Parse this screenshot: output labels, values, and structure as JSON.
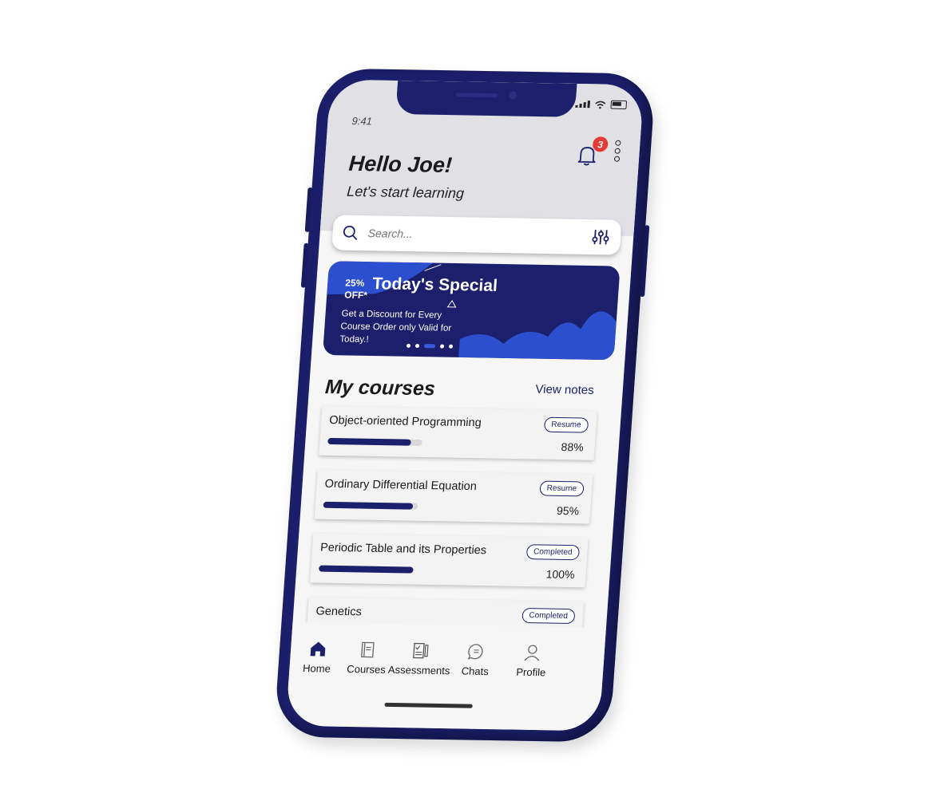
{
  "status_bar": {
    "time": "9:41"
  },
  "header": {
    "greeting": "Hello Joe!",
    "subtitle": "Let's start learning",
    "notification_count": "3"
  },
  "search": {
    "placeholder": "Search..."
  },
  "promo": {
    "discount_percent": "25%",
    "discount_suffix": "OFF*",
    "title": "Today's Special",
    "text": "Get a Discount for Every Course Order only Valid for Today.!",
    "active_slide": 3,
    "slide_count": 5
  },
  "courses_section": {
    "title": "My courses",
    "link": "View notes"
  },
  "courses": [
    {
      "title": "Object-oriented Programming",
      "button": "Resume",
      "progress_label": "88%",
      "progress": 0.88
    },
    {
      "title": "Ordinary Differential Equation",
      "button": "Resume",
      "progress_label": "95%",
      "progress": 0.95
    },
    {
      "title": "Periodic Table and its Properties",
      "button": "Completed",
      "progress_label": "100%",
      "progress": 1.0
    },
    {
      "title": "Genetics",
      "button": "Completed"
    }
  ],
  "nav": [
    {
      "label": "Home",
      "icon": "home-icon",
      "active": true
    },
    {
      "label": "Courses",
      "icon": "book-icon"
    },
    {
      "label": "Assessments",
      "icon": "assessment-icon"
    },
    {
      "label": "Chats",
      "icon": "chat-icon"
    },
    {
      "label": "Profile",
      "icon": "profile-icon"
    }
  ],
  "colors": {
    "primary": "#1c1f6b",
    "accent": "#3b5bdc",
    "badge": "#e53935",
    "header_bg": "#e0e0e5"
  }
}
